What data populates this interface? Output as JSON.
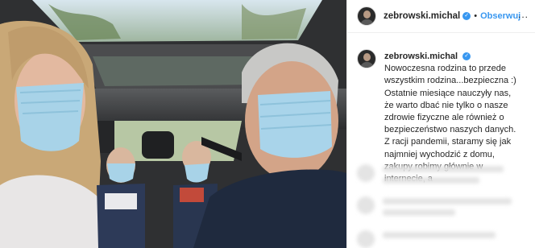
{
  "post": {
    "username": "zebrowski.michal",
    "verified_icon": "verified-badge-icon",
    "follow_label": "Obserwuj",
    "separator": "•",
    "more_label": "...",
    "caption": "Nowoczesna rodzina to przede wszystkim rodzina...bezpieczna :) Ostatnie miesiące nauczyły nas, że warto dbać nie tylko o nasze zdrowie fizyczne ale również o bezpieczeństwo naszych danych. Z racji pandemii, staramy się jak najmniej wychodzić z domu, zakupy robimy głównie w internecie, a"
  },
  "colors": {
    "accent": "#3897f0",
    "text": "#262626",
    "border": "#efefef"
  }
}
